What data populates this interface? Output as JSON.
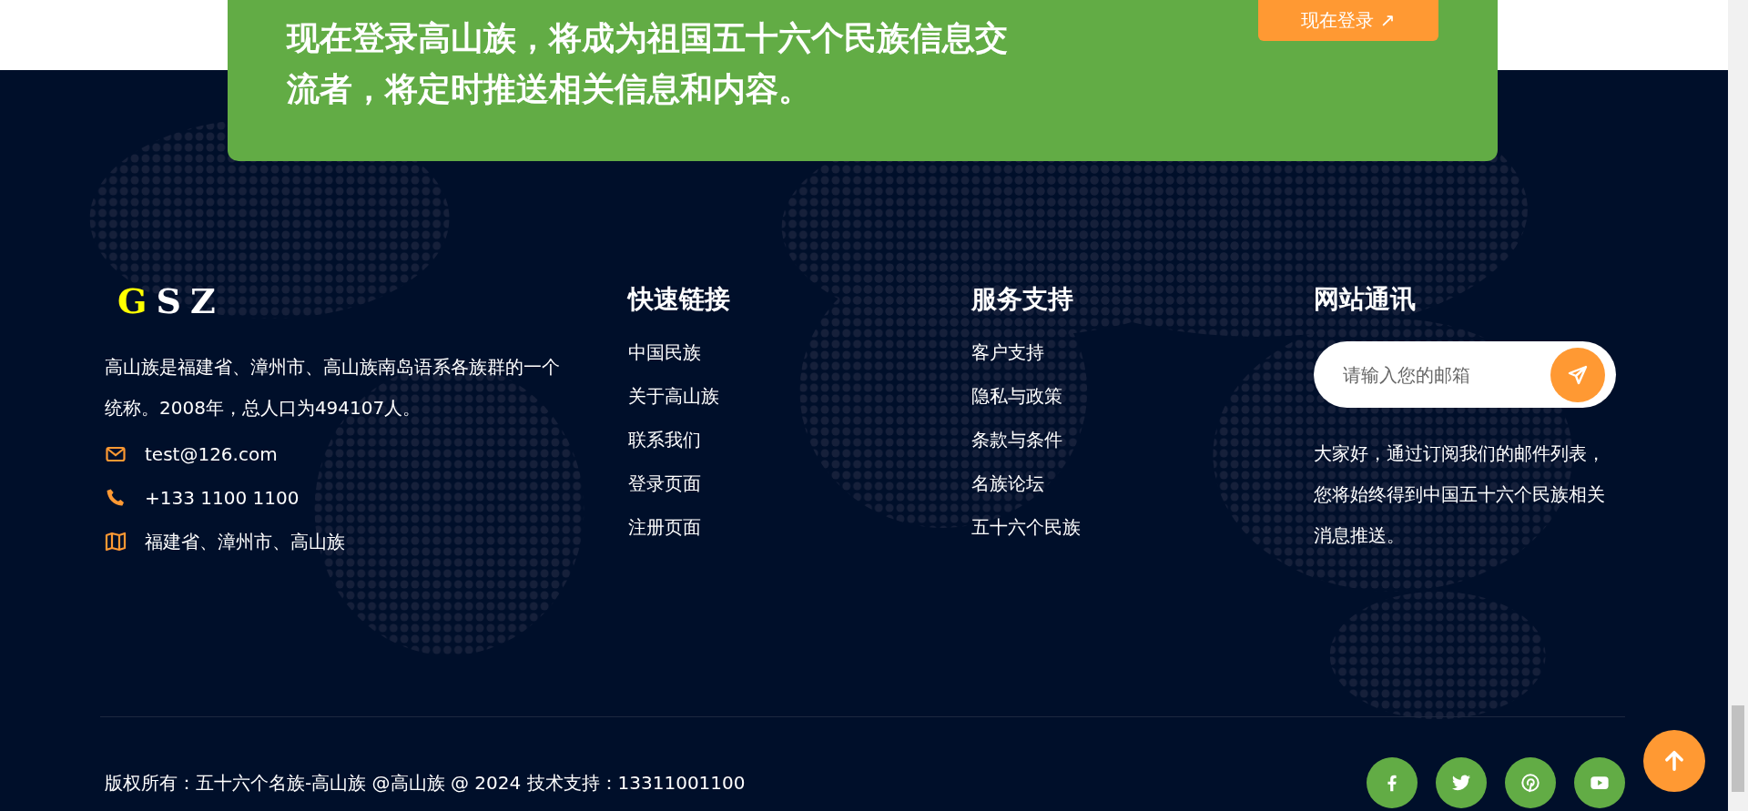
{
  "banner": {
    "heading": "现在登录高山族，将成为祖国五十六个民族信息交流者，将定时推送相关信息和内容。",
    "button": "现在登录 ↗"
  },
  "logo": [
    {
      "text": "G",
      "color": "#ffff00"
    },
    {
      "text": "S",
      "color": "#ffffff"
    },
    {
      "text": "Z",
      "color": "#ffffff"
    }
  ],
  "about": {
    "description": "高山族是福建省、漳州市、高山族南岛语系各族群的一个统称。2008年，总人口为494107人。",
    "contacts": [
      {
        "kind": "email",
        "text": "test@126.com"
      },
      {
        "kind": "phone",
        "text": "+133 1100 1100"
      },
      {
        "kind": "address",
        "text": "福建省、漳州市、高山族"
      }
    ]
  },
  "link_columns": [
    {
      "title": "快速链接",
      "links": [
        "中国民族",
        "关于高山族",
        "联系我们",
        "登录页面",
        "注册页面"
      ]
    },
    {
      "title": "服务支持",
      "links": [
        "客户支持",
        "隐私与政策",
        "条款与条件",
        "名族论坛",
        "五十六个民族"
      ]
    }
  ],
  "newsletter": {
    "title": "网站通讯",
    "placeholder": "请输入您的邮箱",
    "text": "大家好，通过订阅我们的邮件列表，您将始终得到中国五十六个民族相关消息推送。"
  },
  "copyright": "版权所有：五十六个名族-高山族 @高山族 @ 2024 技术支持：13311001100",
  "social": [
    {
      "kind": "facebook"
    },
    {
      "kind": "twitter"
    },
    {
      "kind": "pinterest"
    },
    {
      "kind": "youtube"
    }
  ]
}
